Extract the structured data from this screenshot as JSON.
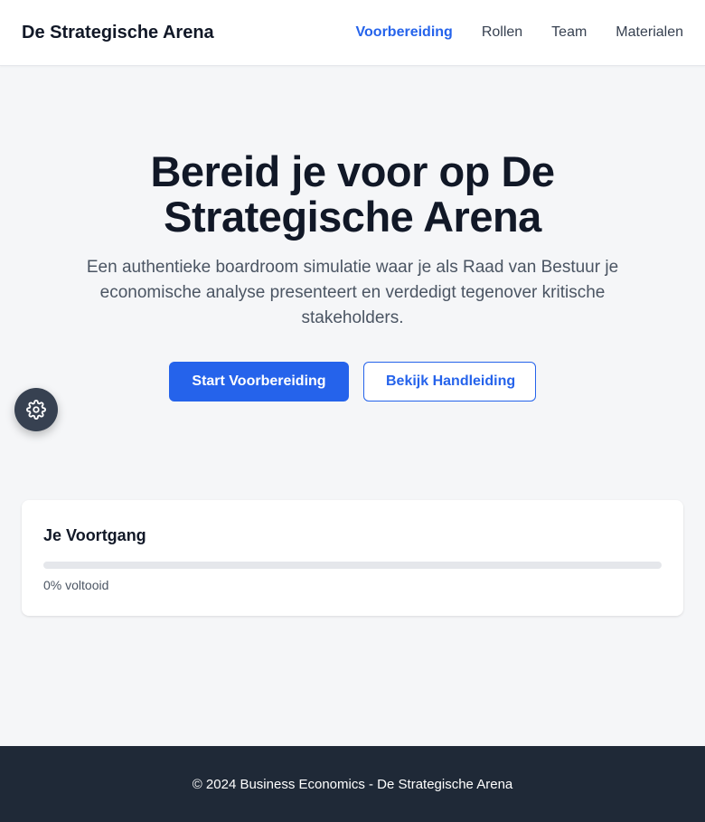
{
  "header": {
    "brand": "De Strategische Arena",
    "nav": [
      {
        "label": "Voorbereiding",
        "active": true
      },
      {
        "label": "Rollen",
        "active": false
      },
      {
        "label": "Team",
        "active": false
      },
      {
        "label": "Materialen",
        "active": false
      }
    ]
  },
  "hero": {
    "title": "Bereid je voor op De Strategische Arena",
    "subtitle": "Een authentieke boardroom simulatie waar je als Raad van Bestuur je economische analyse presenteert en verdedigt tegenover kritische stakeholders.",
    "primary_button": "Start Voorbereiding",
    "secondary_button": "Bekijk Handleiding"
  },
  "settings_button": {
    "icon": "gear-icon"
  },
  "progress": {
    "title": "Je Voortgang",
    "percent": 0,
    "label": "0% voltooid"
  },
  "footer": {
    "text": "© 2024 Business Economics - De Strategische Arena"
  },
  "colors": {
    "accent": "#2563eb",
    "background": "#f5f6f8",
    "footer": "#1f2937",
    "fab": "#374151"
  }
}
